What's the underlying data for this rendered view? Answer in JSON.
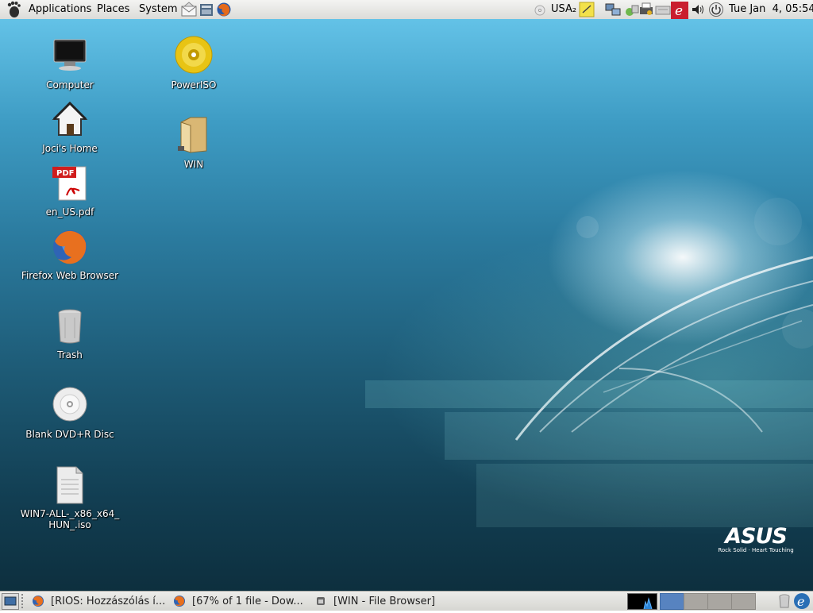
{
  "top_panel": {
    "menus": [
      "Applications",
      "Places",
      "System"
    ],
    "keyboard_layout": "USA₂",
    "clock": "Tue Jan  4, 05:54",
    "icons": [
      "gnome-foot-icon",
      "mail-icon",
      "file-manager-icon",
      "firefox-icon",
      "cd-icon",
      "notes-icon",
      "network-icon",
      "weather-icon",
      "printer-icon",
      "keyboard-icon",
      "app-e-icon",
      "volume-icon",
      "power-icon"
    ]
  },
  "desktop": {
    "icons": [
      {
        "label": "Computer",
        "icon": "computer-icon"
      },
      {
        "label": "PowerISO",
        "icon": "poweriso-icon"
      },
      {
        "label": "Joci's Home",
        "icon": "home-icon"
      },
      {
        "label": "WIN",
        "icon": "folder-icon"
      },
      {
        "label": "en_US.pdf",
        "icon": "pdf-icon"
      },
      {
        "label": "Firefox Web Browser",
        "icon": "firefox-icon"
      },
      {
        "label": "Trash",
        "icon": "trash-icon"
      },
      {
        "label": "Blank DVD+R Disc",
        "icon": "dvd-icon"
      },
      {
        "label": "WIN7-ALL-_x86_x64_",
        "label2": "HUN_.iso",
        "icon": "file-icon"
      }
    ],
    "wallpaper_brand": "ASUS",
    "wallpaper_tagline": "Rock Solid · Heart Touching"
  },
  "bottom_panel": {
    "tasks": [
      {
        "label": "[RIOS: Hozzászólás í...",
        "icon": "firefox-icon"
      },
      {
        "label": "[67% of 1 file - Dow...",
        "icon": "firefox-icon"
      },
      {
        "label": "[WIN - File Browser]",
        "icon": "folder-window-icon"
      }
    ],
    "workspaces": 4,
    "active_workspace": 1
  },
  "colors": {
    "panel": "#e2e2de",
    "desktop_top": "#63c2e7",
    "desktop_bottom": "#0d2f3e",
    "workspace_active": "#5783c0"
  }
}
